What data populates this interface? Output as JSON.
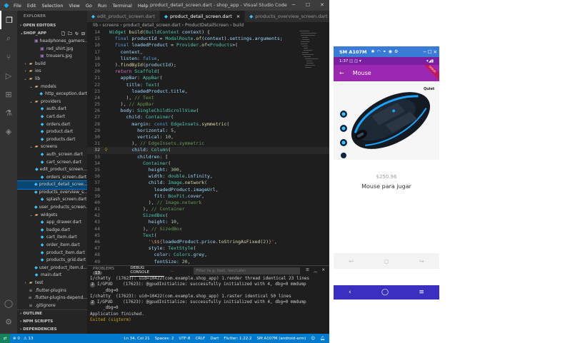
{
  "titlebar": {
    "menu": [
      "File",
      "Edit",
      "Selection",
      "View",
      "Go",
      "Run",
      "Terminal",
      "Help"
    ],
    "title": "product_detail_screen.dart - shop_app - Visual Studio Code"
  },
  "sidebar": {
    "header": "EXPLORER",
    "open_editors": "OPEN EDITORS",
    "project": "SHOP_APP",
    "tree": [
      {
        "label": "headphones_gamers...",
        "depth": 3,
        "kind": "img"
      },
      {
        "label": "red_shirt.jpg",
        "depth": 3,
        "kind": "img"
      },
      {
        "label": "trousers.jpg",
        "depth": 3,
        "kind": "img"
      },
      {
        "label": "build",
        "depth": 1,
        "kind": "fold",
        "chev": "›"
      },
      {
        "label": "ios",
        "depth": 1,
        "kind": "fold",
        "chev": "›"
      },
      {
        "label": "lib",
        "depth": 1,
        "kind": "fold",
        "chev": "⌄"
      },
      {
        "label": "models",
        "depth": 2,
        "kind": "fold",
        "chev": "⌄"
      },
      {
        "label": "http_exception.dart",
        "depth": 3,
        "kind": "dart"
      },
      {
        "label": "providers",
        "depth": 2,
        "kind": "fold",
        "chev": "⌄"
      },
      {
        "label": "auth.dart",
        "depth": 3,
        "kind": "dart"
      },
      {
        "label": "cart.dart",
        "depth": 3,
        "kind": "dart"
      },
      {
        "label": "orders.dart",
        "depth": 3,
        "kind": "dart"
      },
      {
        "label": "product.dart",
        "depth": 3,
        "kind": "dart"
      },
      {
        "label": "products.dart",
        "depth": 3,
        "kind": "dart"
      },
      {
        "label": "screens",
        "depth": 2,
        "kind": "fold",
        "chev": "⌄"
      },
      {
        "label": "auth_screen.dart",
        "depth": 3,
        "kind": "dart"
      },
      {
        "label": "cart_screen.dart",
        "depth": 3,
        "kind": "dart"
      },
      {
        "label": "edit_product_screen...",
        "depth": 3,
        "kind": "dart"
      },
      {
        "label": "orders_screen.dart",
        "depth": 3,
        "kind": "dart"
      },
      {
        "label": "product_detail_scree...",
        "depth": 3,
        "kind": "dart",
        "selected": true
      },
      {
        "label": "products_overview_s...",
        "depth": 3,
        "kind": "dart"
      },
      {
        "label": "splash_screen.dart",
        "depth": 3,
        "kind": "dart"
      },
      {
        "label": "user_products_screen...",
        "depth": 3,
        "kind": "dart"
      },
      {
        "label": "widgets",
        "depth": 2,
        "kind": "fold",
        "chev": "⌄"
      },
      {
        "label": "app_drawer.dart",
        "depth": 3,
        "kind": "dart"
      },
      {
        "label": "badge.dart",
        "depth": 3,
        "kind": "dart"
      },
      {
        "label": "cart_item.dart",
        "depth": 3,
        "kind": "dart"
      },
      {
        "label": "order_item.dart",
        "depth": 3,
        "kind": "dart"
      },
      {
        "label": "product_item.dart",
        "depth": 3,
        "kind": "dart"
      },
      {
        "label": "products_grid.dart",
        "depth": 3,
        "kind": "dart"
      },
      {
        "label": "user_product_item.d...",
        "depth": 3,
        "kind": "dart"
      },
      {
        "label": "main.dart",
        "depth": 2,
        "kind": "dart"
      },
      {
        "label": "test",
        "depth": 1,
        "kind": "fold",
        "chev": "›"
      },
      {
        "label": ".flutter-plugins",
        "depth": 1,
        "kind": "file"
      },
      {
        "label": ".flutter-plugins-depend...",
        "depth": 1,
        "kind": "file"
      },
      {
        "label": ".gitignore",
        "depth": 1,
        "kind": "file"
      }
    ],
    "bottom": [
      "OUTLINE",
      "NPM SCRIPTS",
      "DEPENDENCIES"
    ]
  },
  "tabs": [
    {
      "label": "edit_product_screen.dart",
      "active": false
    },
    {
      "label": "product_detail_screen.dart",
      "active": true,
      "close": "×"
    },
    {
      "label": "products_overview_screen.dart",
      "active": false
    }
  ],
  "breadcrumb": "lib › screens › product_detail_screen.dart › ProductDetailScreen › build",
  "code": [
    {
      "no": "14",
      "html": "<span class='t'>Widget</span> <span class='f'>build</span>(<span class='t'>BuildContext</span> <span class='v'>context</span>) {"
    },
    {
      "no": "15",
      "html": "  <span class='k'>final</span> <span class='v'>productId</span> = <span class='t'>ModalRoute</span>.<span class='f'>of</span>(<span class='v'>context</span>).<span class='v'>settings</span>.<span class='v'>arguments</span>;"
    },
    {
      "no": "16",
      "html": "  <span class='k'>final</span> <span class='v'>loadedProduct</span> = <span class='t'>Provider</span>.<span class='f'>of</span>&lt;<span class='t'>Products</span>&gt;("
    },
    {
      "no": "17",
      "html": "    <span class='v'>context</span>,"
    },
    {
      "no": "18",
      "html": "    <span class='v'>listen</span>: <span class='k'>false</span>,"
    },
    {
      "no": "19",
      "html": "  ).<span class='f'>findById</span>(<span class='v'>productId</span>);"
    },
    {
      "no": "20",
      "html": "  <span class='p'>return</span> <span class='t'>Scaffold</span>("
    },
    {
      "no": "21",
      "html": "    <span class='v'>appBar</span>: <span class='t'>AppBar</span>("
    },
    {
      "no": "22",
      "html": "      <span class='v'>title</span>: <span class='t'>Text</span>("
    },
    {
      "no": "23",
      "html": "        <span class='v'>loadedProduct</span>.<span class='v'>title</span>,"
    },
    {
      "no": "24",
      "html": "      ), <span class='c'>// Text</span>"
    },
    {
      "no": "25",
      "html": "    ), <span class='c'>// AppBar</span>"
    },
    {
      "no": "26",
      "html": "    <span class='v'>body</span>: <span class='t'>SingleChildScrollView</span>("
    },
    {
      "no": "27",
      "html": "      <span class='v'>child</span>: <span class='t'>Container</span>("
    },
    {
      "no": "28",
      "html": "        <span class='v'>margin</span>: <span class='k'>const</span> <span class='t'>EdgeInsets</span>.<span class='f'>symmetric</span>("
    },
    {
      "no": "29",
      "html": "          <span class='v'>horizontal</span>: <span class='n'>5</span>,"
    },
    {
      "no": "30",
      "html": "          <span class='v'>vertical</span>: <span class='n'>10</span>,"
    },
    {
      "no": "31",
      "html": "        ), <span class='c'>// EdgeInsets.symmetric</span>"
    },
    {
      "no": "32",
      "html": "        <span class='v'>child</span>: <span class='t'>Column</span>(",
      "cur": true,
      "bulb": true
    },
    {
      "no": "33",
      "html": "          <span class='v'>children</span>: ["
    },
    {
      "no": "34",
      "html": "            <span class='t'>Container</span>("
    },
    {
      "no": "35",
      "html": "              <span class='v'>height</span>: <span class='n'>300</span>,"
    },
    {
      "no": "36",
      "html": "              <span class='v'>width</span>: <span class='t'>double</span>.<span class='v'>infinity</span>,"
    },
    {
      "no": "37",
      "html": "              <span class='v'>child</span>: <span class='t'>Image</span>.<span class='f'>network</span>("
    },
    {
      "no": "38",
      "html": "                <span class='v'>loadedProduct</span>.<span class='v'>imageUrl</span>,"
    },
    {
      "no": "39",
      "html": "                <span class='v'>fit</span>: <span class='t'>BoxFit</span>.<span class='v'>cover</span>,"
    },
    {
      "no": "40",
      "html": "              ), <span class='c'>// Image.network</span>"
    },
    {
      "no": "41",
      "html": "            ), <span class='c'>// Container</span>"
    },
    {
      "no": "42",
      "html": "            <span class='t'>SizedBox</span>("
    },
    {
      "no": "43",
      "html": "              <span class='v'>height</span>: <span class='n'>10</span>,"
    },
    {
      "no": "44",
      "html": "            ), <span class='c'>// SizedBox</span>"
    },
    {
      "no": "45",
      "html": "            <span class='t'>Text</span>("
    },
    {
      "no": "46",
      "html": "              <span class='s'>'\\$${</span><span class='v'>loadedProduct</span>.<span class='v'>price</span>.<span class='f'>toStringAsFixed</span>(<span class='n'>2</span>)<span class='s'>}'</span>,"
    },
    {
      "no": "47",
      "html": "              <span class='v'>style</span>: <span class='t'>TextStyle</span>("
    },
    {
      "no": "48",
      "html": "                <span class='v'>color</span>: <span class='t'>Colors</span>.<span class='v'>grey</span>,"
    },
    {
      "no": "49",
      "html": "                <span class='v'>fontSize</span>: <span class='n'>20</span>,"
    }
  ],
  "panel": {
    "problems": "PROBLEMS",
    "problems_count": "13",
    "output": "...",
    "debug_console": "DEBUG CONSOLE",
    "filter_placeholder": "Filter (e.g. text, !exclude)"
  },
  "console": [
    {
      "badge": "",
      "text": "I/chatty  (17623): uid=10422(com.example.shop_app) 1.render thread identical 23 lines"
    },
    {
      "badge": "2",
      "text": "I/GPUD    (17623): @gpudInitialize: successfully initialized with 4, dbg=0 mmdump"
    },
    {
      "badge": "",
      "text": "_dbg=0"
    },
    {
      "badge": "",
      "text": "I/chatty  (17623): uid=10422(com.example.shop_app) 1.raster identical 50 lines"
    },
    {
      "badge": "2",
      "text": "I/GPUD    (17623): @gpudInitialize: successfully initialized with 4, dbg=0 mmdump"
    },
    {
      "badge": "",
      "text": "_dbg=0"
    },
    {
      "badge": "",
      "text": "Application finished."
    },
    {
      "badge": "",
      "text": "Exited (sigterm)",
      "exit": true
    }
  ],
  "status": {
    "errors": "0",
    "warnings": "13",
    "position": "Ln 34, Col 21",
    "spaces": "Spaces: 2",
    "encoding": "UTF-8",
    "eol": "CRLF",
    "language": "Dart",
    "flutter": "Flutter: 1.22.2",
    "device": "SM A107M (android-arm)"
  },
  "emulator": {
    "title": "SM A107M",
    "time": "1:37",
    "appbar_title": "Mouse",
    "ribbon": "DEBUG",
    "brand": "Quiet",
    "price": "$250.96",
    "product_title": "Mouse para jugar"
  }
}
